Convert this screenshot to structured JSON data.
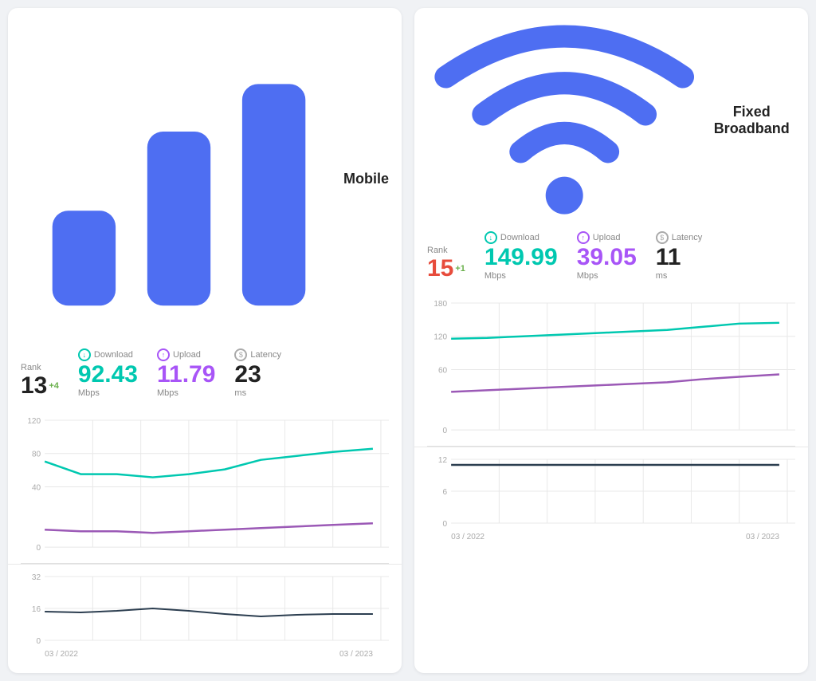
{
  "mobile": {
    "title": "Mobile",
    "rank_label": "Rank",
    "rank_value": "13",
    "rank_change": "+4",
    "download_label": "Download",
    "download_value": "92.43",
    "download_unit": "Mbps",
    "upload_label": "Upload",
    "upload_value": "11.79",
    "upload_unit": "Mbps",
    "latency_label": "Latency",
    "latency_value": "23",
    "latency_unit": "ms",
    "speed_chart": {
      "y_labels": [
        "120",
        "80",
        "40",
        "0"
      ],
      "x_start": "03 / 2022",
      "x_end": "03 / 2023"
    },
    "latency_chart": {
      "y_labels": [
        "32",
        "16",
        "0"
      ]
    }
  },
  "broadband": {
    "title": "Fixed Broadband",
    "rank_label": "Rank",
    "rank_value": "15",
    "rank_change": "+1",
    "download_label": "Download",
    "download_value": "149.99",
    "download_unit": "Mbps",
    "upload_label": "Upload",
    "upload_value": "39.05",
    "upload_unit": "Mbps",
    "latency_label": "Latency",
    "latency_value": "11",
    "latency_unit": "ms",
    "speed_chart": {
      "y_labels": [
        "180",
        "120",
        "60",
        "0"
      ],
      "x_start": "03 / 2022",
      "x_end": "03 / 2023"
    },
    "latency_chart": {
      "y_labels": [
        "12",
        "6",
        "0"
      ]
    }
  },
  "colors": {
    "cyan": "#00c8b0",
    "purple": "#9b59b6",
    "dark": "#2c3e50",
    "gray_line": "#e0e0e0"
  }
}
